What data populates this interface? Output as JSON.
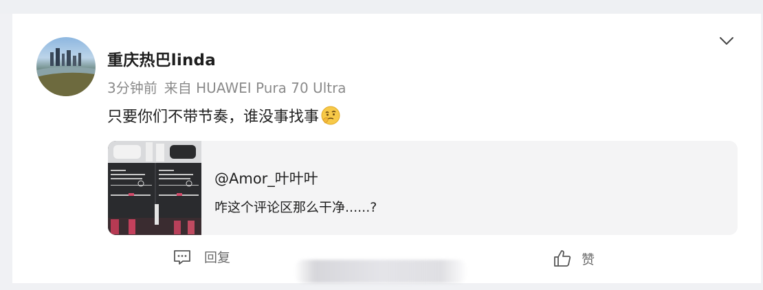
{
  "post": {
    "username": "重庆热巴linda",
    "time": "3分钟前",
    "source": "来自 HUAWEI Pura 70 Ultra",
    "text": "只要你们不带节奏，谁没事找事",
    "emoji": "thinking-face-emoji"
  },
  "quote": {
    "author": "@Amor_叶叶叶",
    "text": "咋这个评论区那么干净......?"
  },
  "actions": {
    "reply_label": "回复",
    "like_label": "赞"
  },
  "icons": {
    "menu": "chevron-down-icon",
    "reply": "comment-icon",
    "like": "thumbs-up-icon"
  },
  "colors": {
    "background": "#f0f1f4",
    "card": "#ffffff",
    "text": "#1e1e1e",
    "muted": "#8a8a8a",
    "quote_bg": "#f4f4f5"
  }
}
